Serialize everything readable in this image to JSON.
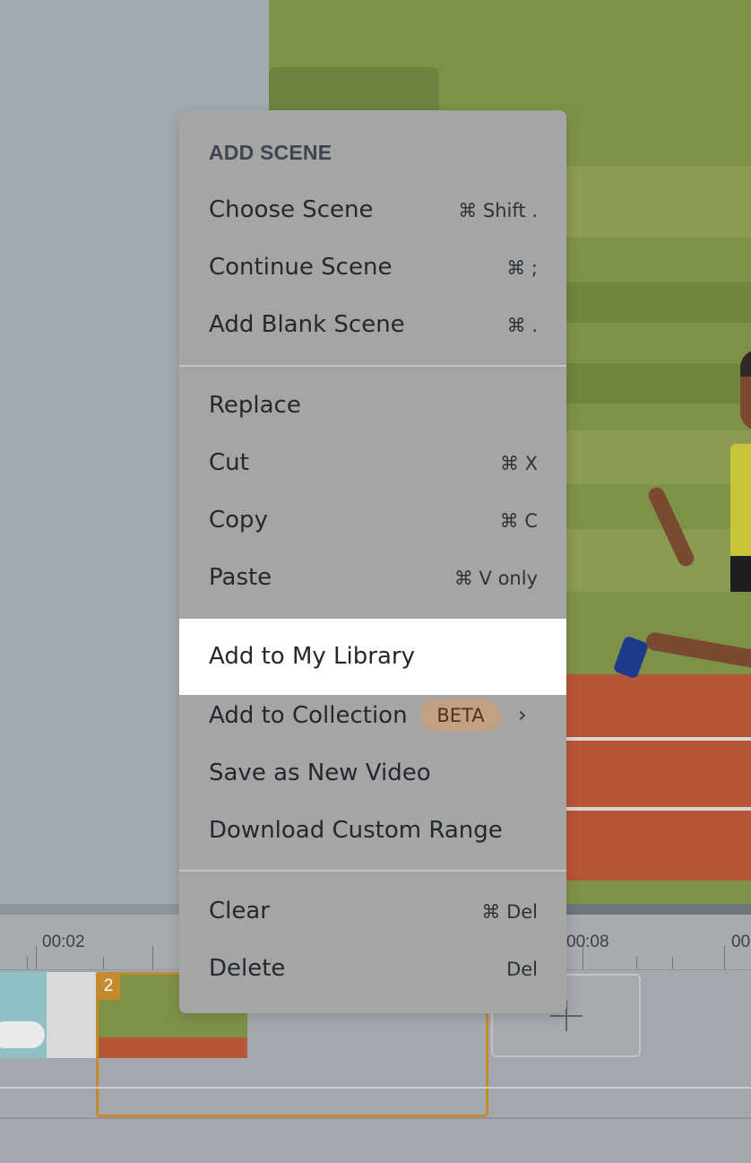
{
  "timeline": {
    "ruler_labels": [
      "00:02",
      "00:08",
      "00"
    ],
    "clip_number": "2"
  },
  "menu": {
    "header": "ADD SCENE",
    "items": [
      {
        "label": "Choose Scene",
        "shortcut": "⌘ Shift ."
      },
      {
        "label": "Continue Scene",
        "shortcut": "⌘ ;"
      },
      {
        "label": "Add Blank Scene",
        "shortcut": "⌘ ."
      },
      {
        "label": "Replace",
        "shortcut": ""
      },
      {
        "label": "Cut",
        "shortcut": "⌘ X"
      },
      {
        "label": "Copy",
        "shortcut": "⌘ C"
      },
      {
        "label": "Paste",
        "shortcut": "⌘ V only"
      },
      {
        "label": "Add to My Library",
        "shortcut": ""
      },
      {
        "label": "Add to Collection",
        "shortcut": "",
        "badge": "BETA",
        "submenu_icon": "chevron-right-icon"
      },
      {
        "label": "Save as New Video",
        "shortcut": ""
      },
      {
        "label": "Download Custom Range",
        "shortcut": ""
      },
      {
        "label": "Clear",
        "shortcut": "⌘ Del"
      },
      {
        "label": "Delete",
        "shortcut": "Del"
      }
    ],
    "highlighted_item": "Add to My Library"
  },
  "colors": {
    "accent": "#c58a2e",
    "beta_badge": "#c2a081",
    "menu_bg": "#a5a5a5"
  }
}
